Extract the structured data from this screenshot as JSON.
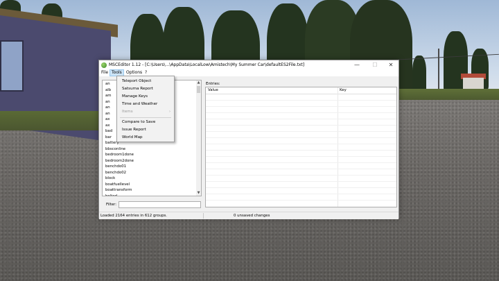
{
  "window": {
    "title": "MSCEditor 1.12 - [C:\\Users\\...\\AppData\\LocalLow\\Amistech\\My Summer Car\\defaultES2File.txt]",
    "minimize_glyph": "—",
    "maximize_glyph": "☐",
    "close_glyph": "✕"
  },
  "menubar": {
    "items": [
      "File",
      "Tools",
      "Options",
      "?"
    ],
    "active": "Tools"
  },
  "tools_menu": {
    "items": [
      "Teleport Object",
      "Satsuma Report",
      "Manage Keys",
      "Time and Weather",
      "Items",
      "Compare to Save",
      "Issue Report",
      "World Map"
    ],
    "disabled": [
      "Items"
    ],
    "submenu_arrow": "›"
  },
  "list": {
    "visible_prefixes": [
      "an",
      "alb",
      "am",
      "an",
      "an",
      "an",
      "ax",
      "ax",
      "bad",
      "bar"
    ],
    "items": [
      "battery",
      "bbsconline",
      "bedroom1done",
      "bedroom2done",
      "benchdo01",
      "benchdo02",
      "block",
      "boatfuellevel",
      "boattransform",
      "bolted"
    ],
    "scroll_up": "▲",
    "scroll_down": "▼"
  },
  "filter": {
    "label": "Filter:",
    "value": ""
  },
  "entries": {
    "label": "Entries:",
    "columns": [
      "Value",
      "Key"
    ]
  },
  "status": {
    "loaded": "Loaded 2164 entries in 612 groups.",
    "changes": "0 unsaved changes"
  }
}
